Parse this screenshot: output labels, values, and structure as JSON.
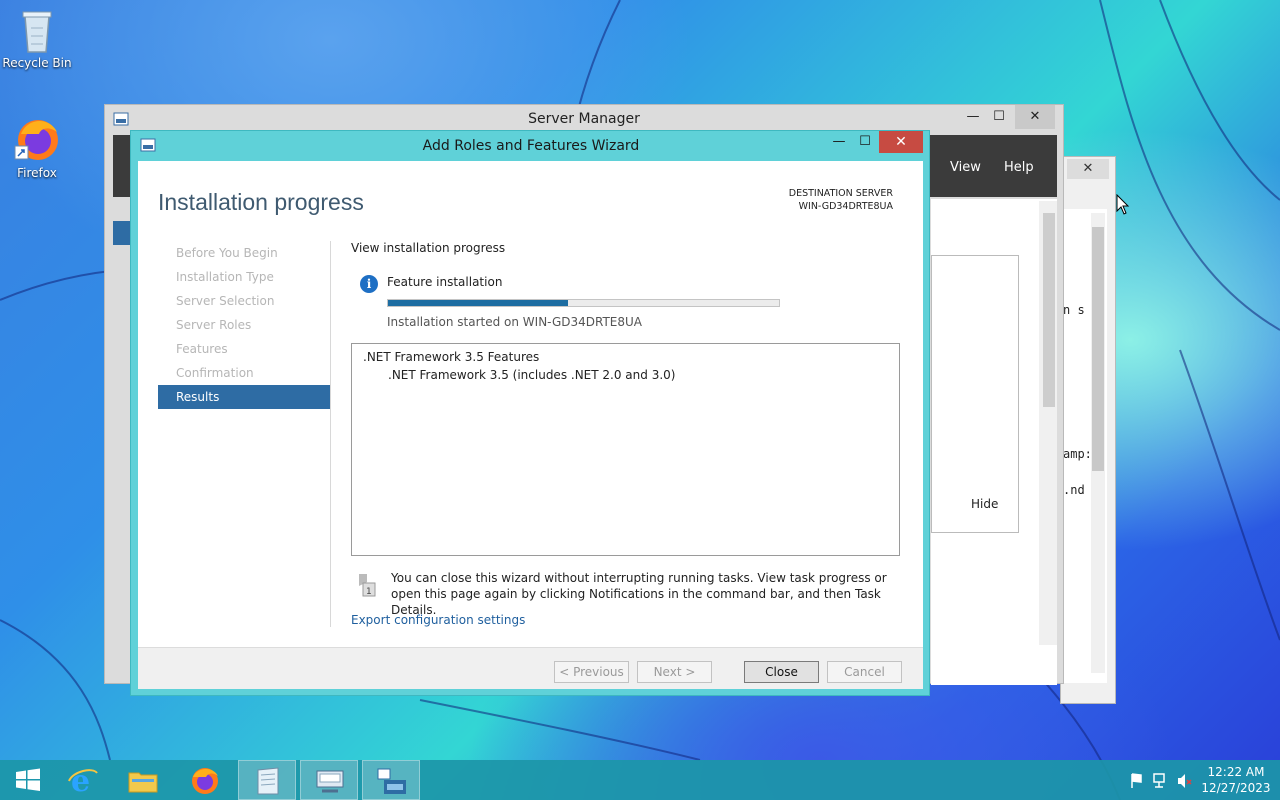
{
  "desktop": {
    "icons": [
      {
        "label": "Recycle Bin",
        "icon": "recycle-bin-icon"
      },
      {
        "label": "Firefox",
        "icon": "firefox-icon"
      }
    ]
  },
  "server_manager": {
    "title": "Server Manager",
    "menu": [
      "View",
      "Help"
    ],
    "hide_label": "Hide"
  },
  "background_window": {
    "close_glyph": "✕",
    "text_fragments": [
      "n s",
      "amp:",
      ".nd"
    ]
  },
  "wizard": {
    "title": "Add Roles and Features Wizard",
    "heading": "Installation progress",
    "destination_label": "DESTINATION SERVER",
    "destination_server": "WIN-GD34DRTE8UA",
    "nav": [
      {
        "label": "Before You Begin",
        "active": false
      },
      {
        "label": "Installation Type",
        "active": false
      },
      {
        "label": "Server Selection",
        "active": false
      },
      {
        "label": "Server Roles",
        "active": false
      },
      {
        "label": "Features",
        "active": false
      },
      {
        "label": "Confirmation",
        "active": false
      },
      {
        "label": "Results",
        "active": true
      }
    ],
    "view_progress_label": "View installation progress",
    "status_label": "Feature installation",
    "progress_fraction": 0.46,
    "started_text": "Installation started on WIN-GD34DRTE8UA",
    "features": [
      ".NET Framework 3.5 Features",
      ".NET Framework 3.5 (includes .NET 2.0 and 3.0)"
    ],
    "note": "You can close this wizard without interrupting running tasks. View task progress or open this page again by clicking Notifications in the command bar, and then Task Details.",
    "export_link": "Export configuration settings",
    "buttons": {
      "previous": "< Previous",
      "next": "Next >",
      "close": "Close",
      "cancel": "Cancel"
    },
    "colors": {
      "accent": "#2e6ca4",
      "progress": "#1d6da2",
      "frame": "#5fd1d8",
      "close_button": "#c74b42"
    }
  },
  "taskbar": {
    "apps": [
      "start",
      "internet-explorer",
      "file-explorer",
      "firefox",
      "notepad",
      "keyboard-app",
      "server-manager"
    ],
    "time": "12:22 AM",
    "date": "12/27/2023"
  }
}
